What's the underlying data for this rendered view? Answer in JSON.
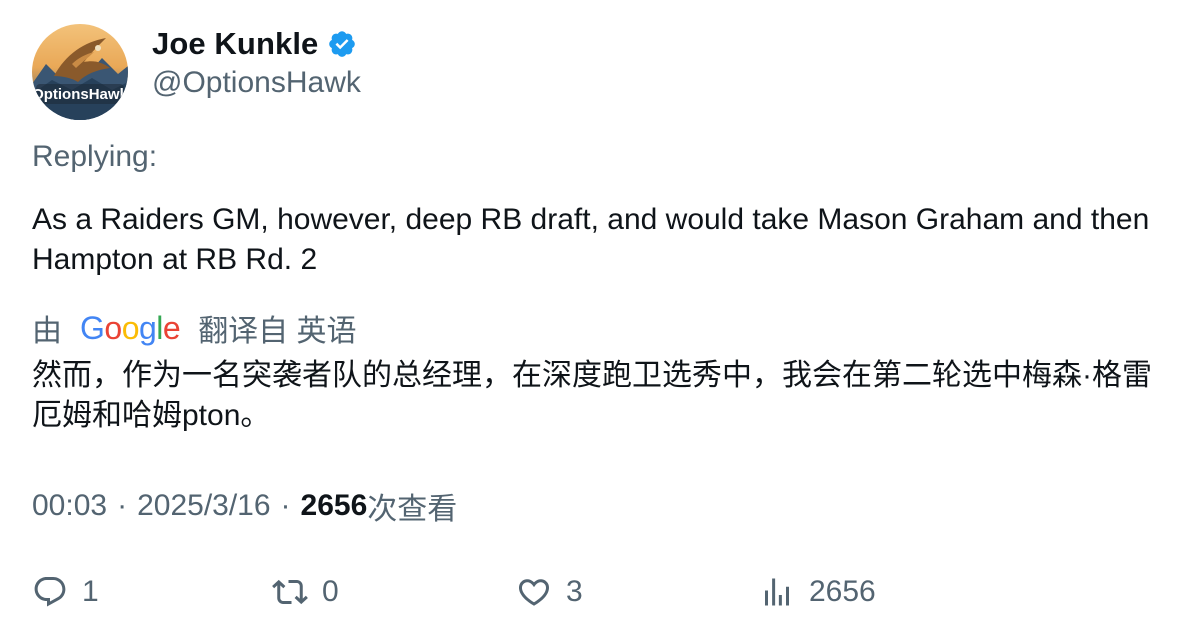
{
  "author": {
    "display_name": "Joe Kunkle",
    "handle": "@OptionsHawk",
    "verified": true,
    "avatar_text": "OptionsHawk"
  },
  "replying_label": "Replying:",
  "tweet_text": "As a Raiders GM, however, deep RB draft, and would take Mason Graham and then Hampton at RB Rd. 2",
  "translation": {
    "by_label": "由",
    "provider": "Google",
    "from_label": "翻译自 英语",
    "text": "然而，作为一名突袭者队的总经理，在深度跑卫选秀中，我会在第二轮选中梅森·格雷厄姆和哈姆pton。"
  },
  "meta": {
    "time": "00:03",
    "date": "2025/3/16",
    "views_count": "2656",
    "views_label": "次查看",
    "separator": "·"
  },
  "actions": {
    "reply_count": "1",
    "retweet_count": "0",
    "like_count": "3",
    "views_count": "2656"
  },
  "colors": {
    "text_primary": "#0f1419",
    "text_secondary": "#536471",
    "verified_blue": "#1d9bf0",
    "google_blue": "#4285F4",
    "google_red": "#EA4335",
    "google_yellow": "#FBBC05",
    "google_green": "#34A853"
  },
  "icons": {
    "reply": "reply-icon",
    "retweet": "retweet-icon",
    "like": "heart-icon",
    "views": "views-icon",
    "verified": "verified-badge-icon"
  }
}
